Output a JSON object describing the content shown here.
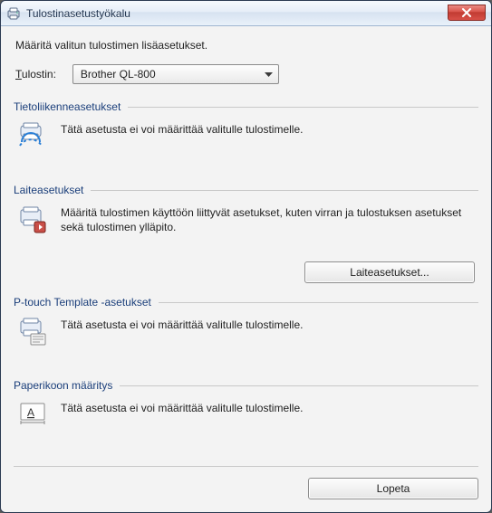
{
  "window": {
    "title": "Tulostinasetustyökalu"
  },
  "intro": "Määritä valitun tulostimen lisäasetukset.",
  "printer_row": {
    "label_prefix": "T",
    "label_rest": "ulostin:",
    "selected": "Brother QL-800"
  },
  "groups": {
    "comm": {
      "title": "Tietoliikenneasetukset",
      "desc": "Tätä asetusta ei voi määrittää valitulle tulostimelle."
    },
    "device": {
      "title": "Laiteasetukset",
      "desc": "Määritä tulostimen käyttöön liittyvät asetukset, kuten virran ja tulostuksen asetukset sekä tulostimen ylläpito.",
      "button": "Laiteasetukset..."
    },
    "ptouch": {
      "title": "P-touch Template -asetukset",
      "desc": "Tätä asetusta ei voi määrittää valitulle tulostimelle."
    },
    "paper": {
      "title": "Paperikoon määritys",
      "desc": "Tätä asetusta ei voi määrittää valitulle tulostimelle."
    }
  },
  "footer": {
    "exit": "Lopeta"
  }
}
